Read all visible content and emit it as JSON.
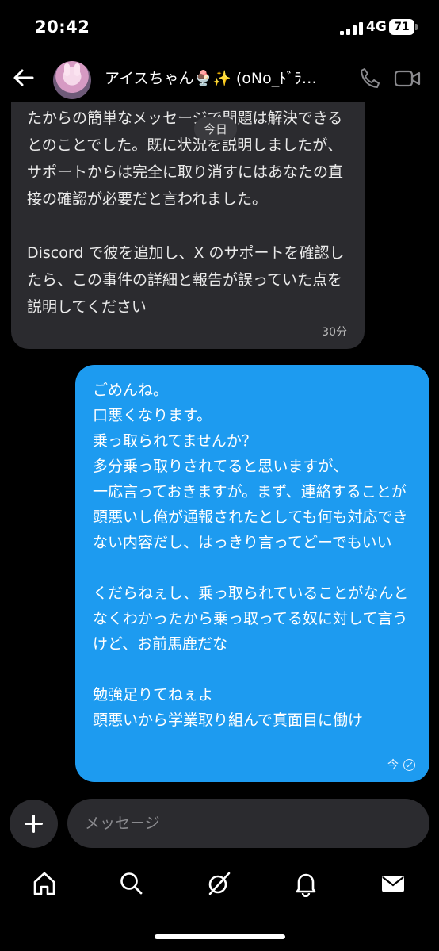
{
  "status_bar": {
    "time": "20:42",
    "network": "4G",
    "battery": "71"
  },
  "header": {
    "contact_name": "アイスちゃん🍨✨ (oNo_ﾄﾞﾗ…",
    "icons": {
      "back": "back-arrow-icon",
      "call": "phone-icon",
      "video": "video-camera-icon"
    }
  },
  "thread": {
    "day_separator": "今日",
    "incoming": {
      "paragraphs": [
        "たことを知らせてほしいとのことでした。あなたからの簡単なメッセージで問題は解決できるとのことでした。既に状況を説明しましたが、サポートからは完全に取り消すにはあなたの直接の確認が必要だと言われました。",
        "Discord で彼を追加し、X のサポートを確認したら、この事件の詳細と報告が誤っていた点を説明してください"
      ],
      "time": "30分"
    },
    "outgoing": {
      "paragraphs": [
        "ごめんね。\n口悪くなります。\n乗っ取られてませんか？\n多分乗っ取りされてると思いますが、\n一応言っておきますが。まず、連絡することが頭悪いし俺が通報されたとしても何も対応できない内容だし、はっきり言ってどーでもいい",
        "くだらねぇし、乗っ取られていることがなんとなくわかったから乗っ取ってる奴に対して言うけど、お前馬鹿だな",
        "勉強足りてねぇよ\n頭悪いから学業取り組んで真面目に働け"
      ],
      "time": "今",
      "status_icon": "read-check-icon"
    }
  },
  "composer": {
    "placeholder": "メッセージ",
    "add_icon": "plus-icon"
  },
  "bottom_nav": {
    "items": [
      "home-icon",
      "search-icon",
      "grok-icon",
      "notifications-bell-icon",
      "messages-envelope-icon"
    ]
  }
}
